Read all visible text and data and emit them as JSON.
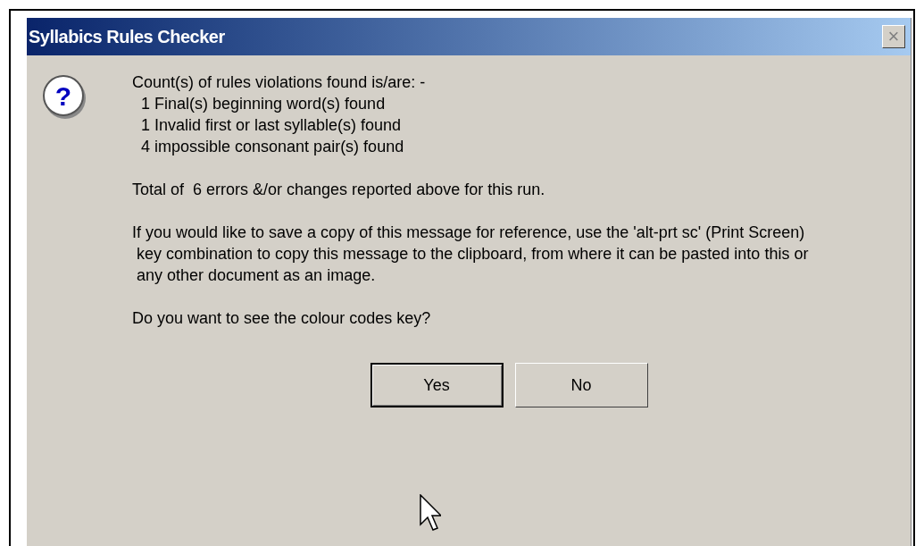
{
  "window": {
    "title": "Syllabics Rules Checker",
    "close": "×"
  },
  "message": {
    "icon": "?",
    "paragraphs": [
      [
        "Count(s) of rules violations found is/are: -",
        "  1 Final(s) beginning word(s) found",
        "  1 Invalid first or last syllable(s) found",
        "  4 impossible consonant pair(s) found"
      ],
      [
        "Total of  6 errors &/or changes reported above for this run."
      ],
      [
        "If you would like to save a copy of this message for reference, use the 'alt-prt sc' (Print Screen)",
        " key combination to copy this message to the clipboard, from where it can be pasted into this or",
        " any other document as an image."
      ],
      [
        "Do you want to see the colour codes key?"
      ]
    ]
  },
  "buttons": [
    {
      "label": "Yes",
      "default": true
    },
    {
      "label": "No",
      "default": false
    }
  ]
}
